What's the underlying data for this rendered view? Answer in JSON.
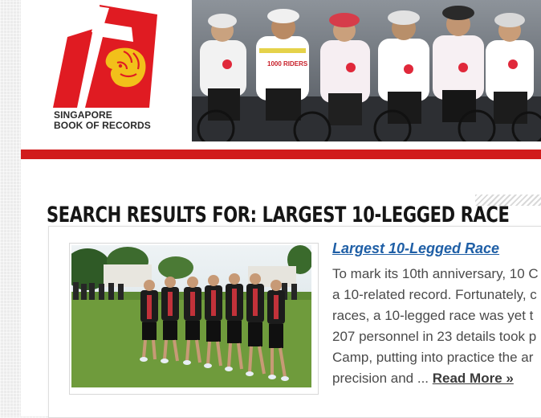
{
  "site": {
    "logo_line1": "SINGAPORE",
    "logo_line2": "BOOK OF RECORDS",
    "brand_red": "#e01b22",
    "brand_gold": "#f2c01a"
  },
  "banner": {
    "jersey_text": "1000 RIDERS"
  },
  "search": {
    "heading": "SEARCH RESULTS FOR: LARGEST 10-LEGGED RACE"
  },
  "results": [
    {
      "title": "Largest 10-Legged Race",
      "excerpt_lines": [
        "To mark its 10th anniversary, 10 C",
        "a 10-related record. Fortunately, c",
        "races, a 10-legged race was yet t",
        "207 personnel in 23 details took p",
        "Camp, putting into practice the ar",
        "precision and ... "
      ],
      "read_more": "Read More »"
    }
  ],
  "colors": {
    "link_blue": "#1f5fa6",
    "red_bar": "#d11c1c"
  }
}
